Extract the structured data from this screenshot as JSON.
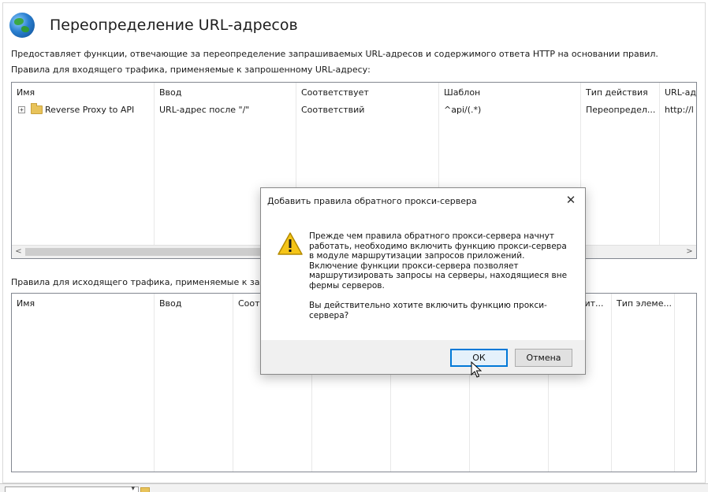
{
  "header": {
    "title": "Переопределение URL-адресов",
    "description": "Предоставляет функции, отвечающие за переопределение запрашиваемых URL-адресов и содержимого ответа HTTP на основании правил."
  },
  "inbound": {
    "label": "Правила для входящего трафика, применяемые к запрошенному URL-адресу:",
    "columns": [
      "Имя",
      "Ввод",
      "Соответствует",
      "Шаблон",
      "Тип действия",
      "URL-ад"
    ],
    "rows": [
      {
        "expander": "+",
        "name": "Reverse Proxy to API",
        "input": "URL-адрес после \"/\"",
        "match": "Соответствий",
        "pattern": "^api/(.*)",
        "action_type": "Переопредел...",
        "url": "http://l"
      }
    ],
    "scroll_left": "<",
    "scroll_right": ">"
  },
  "outbound": {
    "label": "Правила для исходящего трафика, применяемые к загол",
    "columns": [
      "Имя",
      "Ввод",
      "Соот",
      "вит...",
      "Тип элеме..."
    ]
  },
  "dialog": {
    "title": "Добавить правила обратного прокси-сервера",
    "close": "✕",
    "message_1": "Прежде чем правила обратного прокси-сервера начнут работать, необходимо включить функцию прокси-сервера в модуле маршрутизации запросов приложений. Включение функции прокси-сервера позволяет маршрутизировать запросы на серверы, находящиеся вне фермы серверов.",
    "message_2": "Вы действительно хотите включить функцию прокси-сервера?",
    "ok_label": "ОК",
    "cancel_label": "Отмена",
    "icon": "warning-icon"
  },
  "colors": {
    "accent": "#0078d7",
    "warning": "#f5c518"
  }
}
